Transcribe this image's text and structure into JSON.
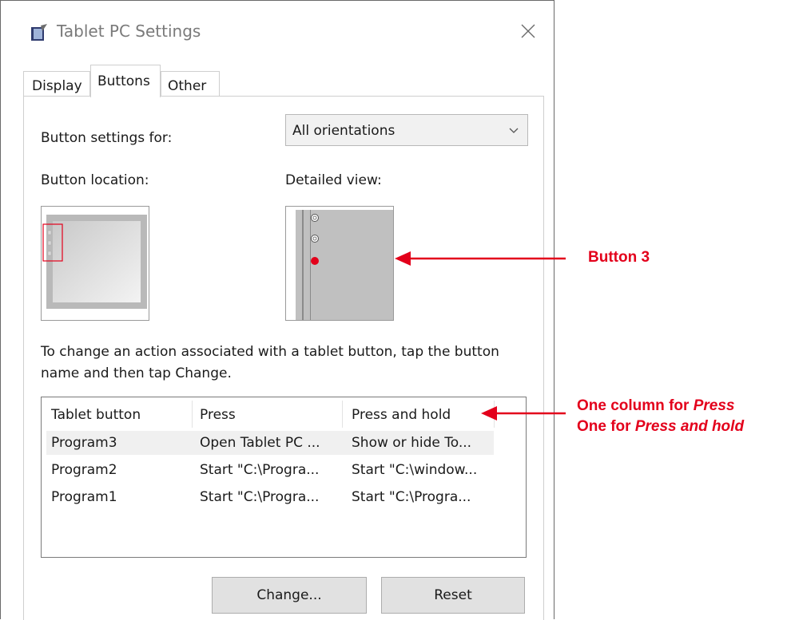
{
  "window": {
    "title": "Tablet PC Settings",
    "close_icon": "close-icon",
    "app_icon": "tablet-pc-icon"
  },
  "tabs": [
    {
      "label": "Display",
      "selected": false
    },
    {
      "label": "Buttons",
      "selected": true
    },
    {
      "label": "Other",
      "selected": false
    }
  ],
  "settings_for": {
    "label": "Button settings for:",
    "value": "All orientations"
  },
  "location": {
    "label": "Button location:"
  },
  "detail": {
    "label": "Detailed view:"
  },
  "hint": "To change an action associated with a tablet button, tap the button name and then tap Change.",
  "list": {
    "columns": [
      "Tablet button",
      "Press",
      "Press and hold"
    ],
    "rows": [
      {
        "name": "Program3",
        "press": "Open Tablet PC ...",
        "hold": "Show or hide To...",
        "selected": true
      },
      {
        "name": "Program2",
        "press": "Start \"C:\\Progra...",
        "hold": "Start \"C:\\window...",
        "selected": false
      },
      {
        "name": "Program1",
        "press": "Start \"C:\\Progra...",
        "hold": "Start \"C:\\Progra...",
        "selected": false
      }
    ]
  },
  "buttons": {
    "change": "Change...",
    "reset": "Reset"
  },
  "annotations": {
    "button3": "Button 3",
    "press_line1_prefix": "One column for ",
    "press_line1_em": "Press",
    "press_line2_prefix": "One for ",
    "press_line2_em": "Press and hold"
  },
  "colors": {
    "annotation": "#e3001b",
    "button_face": "#e1e1e1",
    "selection": "#f0f0f0"
  }
}
